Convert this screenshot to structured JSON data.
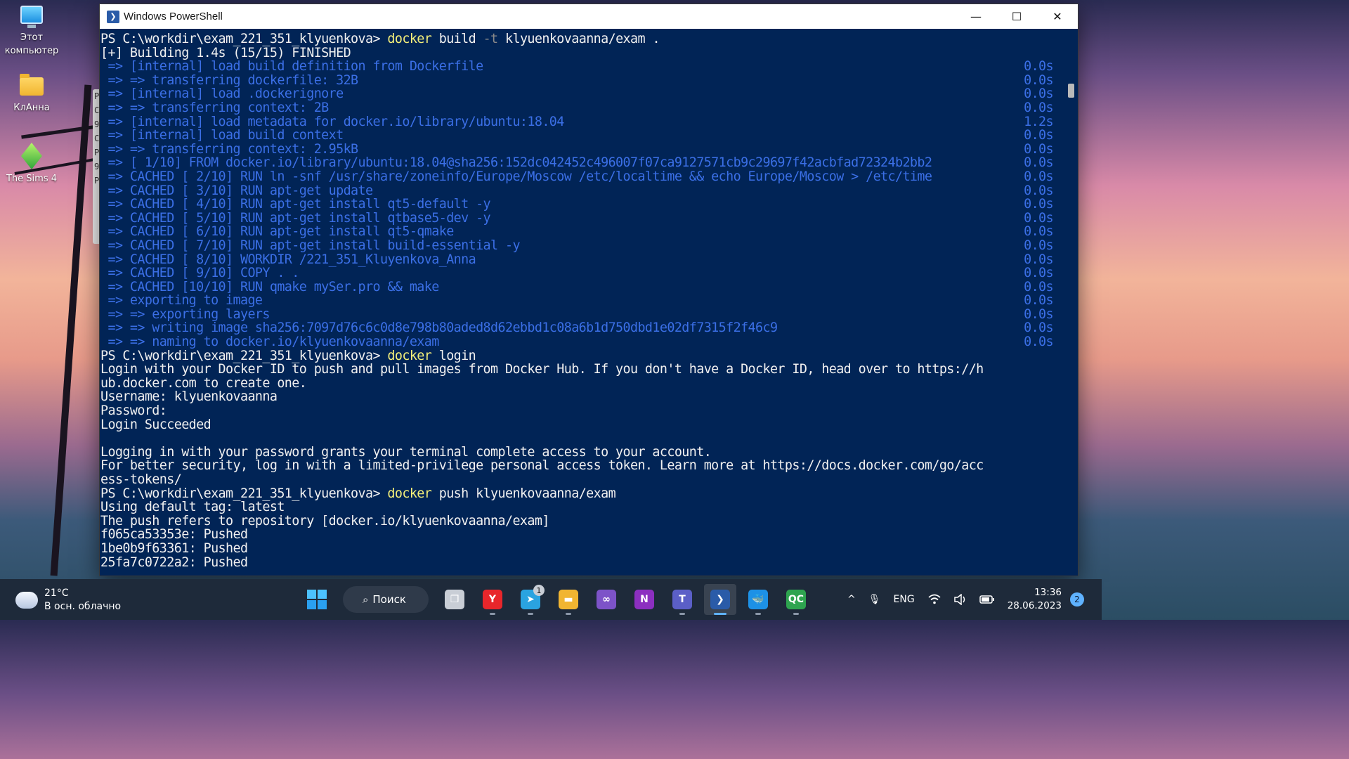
{
  "desktop": {
    "icons": [
      {
        "label": "Этот компьютер",
        "icon": "computer-icon"
      },
      {
        "label": "КлАнна",
        "icon": "folder-icon"
      },
      {
        "label": "The Sims 4",
        "icon": "sims-plumbob-icon"
      }
    ],
    "background_window_letters": [
      "P",
      "C",
      "9",
      "C",
      "P",
      "9",
      "P"
    ]
  },
  "window": {
    "title": "Windows PowerShell",
    "minimize": "—",
    "maximize": "☐",
    "close": "✕"
  },
  "console": {
    "lines": [
      {
        "type": "cmd",
        "prompt": "PS C:\\workdir\\exam_221_351_klyuenkova> ",
        "cmd": "docker",
        "rest_a": " build ",
        "flag": "-t",
        "rest_b": " klyuenkovaanna/exam ."
      },
      {
        "type": "text",
        "text": "[+] Building 1.4s (15/15) FINISHED"
      },
      {
        "type": "step",
        "text": " => [internal] load build definition from Dockerfile",
        "dur": "0.0s"
      },
      {
        "type": "step",
        "text": " => => transferring dockerfile: 32B",
        "dur": "0.0s"
      },
      {
        "type": "step",
        "text": " => [internal] load .dockerignore",
        "dur": "0.0s"
      },
      {
        "type": "step",
        "text": " => => transferring context: 2B",
        "dur": "0.0s"
      },
      {
        "type": "step",
        "text": " => [internal] load metadata for docker.io/library/ubuntu:18.04",
        "dur": "1.2s"
      },
      {
        "type": "step",
        "text": " => [internal] load build context",
        "dur": "0.0s"
      },
      {
        "type": "step",
        "text": " => => transferring context: 2.95kB",
        "dur": "0.0s"
      },
      {
        "type": "step",
        "text": " => [ 1/10] FROM docker.io/library/ubuntu:18.04@sha256:152dc042452c496007f07ca9127571cb9c29697f42acbfad72324b2bb2",
        "dur": "0.0s"
      },
      {
        "type": "step",
        "text": " => CACHED [ 2/10] RUN ln -snf /usr/share/zoneinfo/Europe/Moscow /etc/localtime && echo Europe/Moscow > /etc/time",
        "dur": "0.0s"
      },
      {
        "type": "step",
        "text": " => CACHED [ 3/10] RUN apt-get update",
        "dur": "0.0s"
      },
      {
        "type": "step",
        "text": " => CACHED [ 4/10] RUN apt-get install qt5-default -y",
        "dur": "0.0s"
      },
      {
        "type": "step",
        "text": " => CACHED [ 5/10] RUN apt-get install qtbase5-dev -y",
        "dur": "0.0s"
      },
      {
        "type": "step",
        "text": " => CACHED [ 6/10] RUN apt-get install qt5-qmake",
        "dur": "0.0s"
      },
      {
        "type": "step",
        "text": " => CACHED [ 7/10] RUN apt-get install build-essential -y",
        "dur": "0.0s"
      },
      {
        "type": "step",
        "text": " => CACHED [ 8/10] WORKDIR /221_351_Kluyenkova_Anna",
        "dur": "0.0s"
      },
      {
        "type": "step",
        "text": " => CACHED [ 9/10] COPY . .",
        "dur": "0.0s"
      },
      {
        "type": "step",
        "text": " => CACHED [10/10] RUN qmake mySer.pro && make",
        "dur": "0.0s"
      },
      {
        "type": "step",
        "text": " => exporting to image",
        "dur": "0.0s"
      },
      {
        "type": "step",
        "text": " => => exporting layers",
        "dur": "0.0s"
      },
      {
        "type": "step",
        "text": " => => writing image sha256:7097d76c6c0d8e798b80aded8d62ebbd1c08a6b1d750dbd1e02df7315f2f46c9",
        "dur": "0.0s"
      },
      {
        "type": "step",
        "text": " => => naming to docker.io/klyuenkovaanna/exam",
        "dur": "0.0s"
      },
      {
        "type": "cmd",
        "prompt": "PS C:\\workdir\\exam_221_351_klyuenkova> ",
        "cmd": "docker",
        "rest_a": " login",
        "flag": "",
        "rest_b": ""
      },
      {
        "type": "text",
        "text": "Login with your Docker ID to push and pull images from Docker Hub. If you don't have a Docker ID, head over to https://h"
      },
      {
        "type": "text",
        "text": "ub.docker.com to create one."
      },
      {
        "type": "text",
        "text": "Username: klyuenkovaanna"
      },
      {
        "type": "text",
        "text": "Password:"
      },
      {
        "type": "text",
        "text": "Login Succeeded"
      },
      {
        "type": "text",
        "text": ""
      },
      {
        "type": "text",
        "text": "Logging in with your password grants your terminal complete access to your account."
      },
      {
        "type": "text",
        "text": "For better security, log in with a limited-privilege personal access token. Learn more at https://docs.docker.com/go/acc"
      },
      {
        "type": "text",
        "text": "ess-tokens/"
      },
      {
        "type": "cmd",
        "prompt": "PS C:\\workdir\\exam_221_351_klyuenkova> ",
        "cmd": "docker",
        "rest_a": " push klyuenkovaanna/exam",
        "flag": "",
        "rest_b": ""
      },
      {
        "type": "text",
        "text": "Using default tag: latest"
      },
      {
        "type": "text",
        "text": "The push refers to repository [docker.io/klyuenkovaanna/exam]"
      },
      {
        "type": "text",
        "text": "f065ca53353e: Pushed"
      },
      {
        "type": "text",
        "text": "1be0b9f63361: Pushed"
      },
      {
        "type": "text",
        "text": "25fa7c0722a2: Pushed"
      }
    ]
  },
  "taskbar": {
    "weather": {
      "temp": "21°C",
      "desc": "В осн. облачно",
      "icon": "partly-cloudy-icon"
    },
    "search_label": "Поиск",
    "apps": [
      {
        "name": "task-view",
        "icon": "task-view-icon",
        "glyph": "❐",
        "color": "#c9ced6",
        "running": false
      },
      {
        "name": "yandex-browser",
        "icon": "yandex-icon",
        "glyph": "Y",
        "color": "#e8262b",
        "running": true
      },
      {
        "name": "telegram",
        "icon": "telegram-icon",
        "glyph": "➤",
        "color": "#2aa3e0",
        "running": true,
        "badge": "1"
      },
      {
        "name": "file-explorer",
        "icon": "folder-icon",
        "glyph": "▬",
        "color": "#f1b531",
        "running": true
      },
      {
        "name": "visual-studio",
        "icon": "visual-studio-icon",
        "glyph": "∞",
        "color": "#7d53c8",
        "running": false
      },
      {
        "name": "onenote",
        "icon": "onenote-icon",
        "glyph": "N",
        "color": "#8c2fc0",
        "running": false
      },
      {
        "name": "teams",
        "icon": "teams-icon",
        "glyph": "T",
        "color": "#5b5fc7",
        "running": true
      },
      {
        "name": "powershell",
        "icon": "powershell-icon",
        "glyph": "❯",
        "color": "#2a5ba8",
        "running": true,
        "active": true
      },
      {
        "name": "docker-desktop",
        "icon": "docker-whale-icon",
        "glyph": "🐳",
        "color": "#1d91e6",
        "running": true
      },
      {
        "name": "qt-creator",
        "icon": "qt-creator-icon",
        "glyph": "QC",
        "color": "#2ea44f",
        "running": true
      }
    ],
    "tray": {
      "chevron": "^",
      "mic": "🎙",
      "lang": "ENG",
      "wifi": "wifi-icon",
      "volume": "volume-icon",
      "battery": "battery-icon",
      "time": "13:36",
      "date": "28.06.2023",
      "notifications": "2"
    }
  },
  "colors": {
    "console_bg": "#012456",
    "console_fg": "#f0f0f0",
    "docker_step": "#3b6fe6",
    "command": "#f5f07a",
    "flag": "#8a8a8a",
    "taskbar_bg": "#1e2a3a",
    "accent": "#5fb2ff"
  }
}
